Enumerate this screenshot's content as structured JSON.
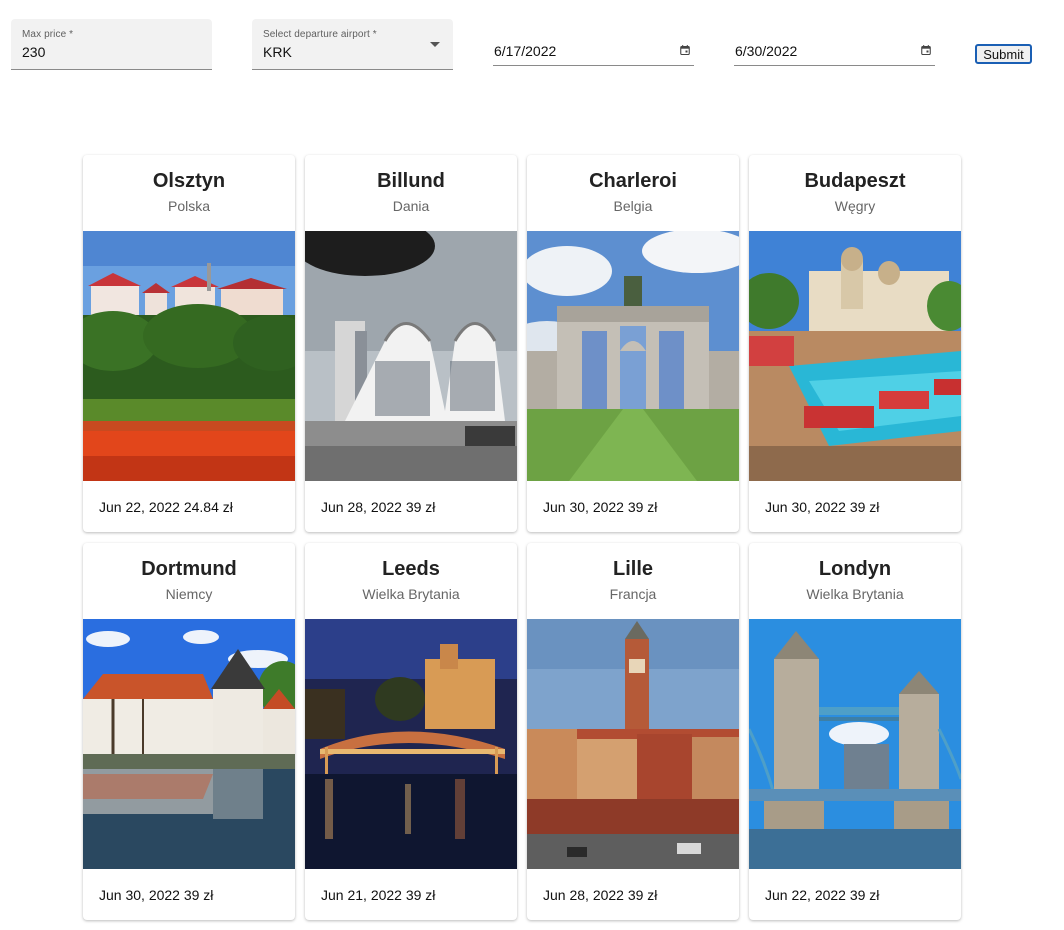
{
  "filters": {
    "max_price_label": "Max price *",
    "max_price_value": "230",
    "airport_label": "Select departure airport *",
    "airport_value": "KRK",
    "date_from": "6/17/2022",
    "date_to": "6/30/2022",
    "submit_label": "Submit"
  },
  "destinations": [
    {
      "city": "Olsztyn",
      "country": "Polska",
      "date": "Jun 22, 2022",
      "price": "24.84 zł",
      "footer": "Jun 22, 2022 24.84 zł",
      "photo_icon": "landscape-photo"
    },
    {
      "city": "Billund",
      "country": "Dania",
      "date": "Jun 28, 2022",
      "price": "39 zł",
      "footer": "Jun 28, 2022 39 zł",
      "photo_icon": "landscape-photo"
    },
    {
      "city": "Charleroi",
      "country": "Belgia",
      "date": "Jun 30, 2022",
      "price": "39 zł",
      "footer": "Jun 30, 2022 39 zł",
      "photo_icon": "landscape-photo"
    },
    {
      "city": "Budapeszt",
      "country": "Węgry",
      "date": "Jun 30, 2022",
      "price": "39 zł",
      "footer": "Jun 30, 2022 39 zł",
      "photo_icon": "landscape-photo"
    },
    {
      "city": "Dortmund",
      "country": "Niemcy",
      "date": "Jun 30, 2022",
      "price": "39 zł",
      "footer": "Jun 30, 2022 39 zł",
      "photo_icon": "landscape-photo"
    },
    {
      "city": "Leeds",
      "country": "Wielka Brytania",
      "date": "Jun 21, 2022",
      "price": "39 zł",
      "footer": "Jun 21, 2022 39 zł",
      "photo_icon": "landscape-photo"
    },
    {
      "city": "Lille",
      "country": "Francja",
      "date": "Jun 28, 2022",
      "price": "39 zł",
      "footer": "Jun 28, 2022 39 zł",
      "photo_icon": "landscape-photo"
    },
    {
      "city": "Londyn",
      "country": "Wielka Brytania",
      "date": "Jun 22, 2022",
      "price": "39 zł",
      "footer": "Jun 22, 2022 39 zł",
      "photo_icon": "landscape-photo"
    }
  ],
  "colors": {
    "field_background": "#f2f2f2",
    "submit_border": "#1a5fb4",
    "secondary_text": "#666666"
  }
}
